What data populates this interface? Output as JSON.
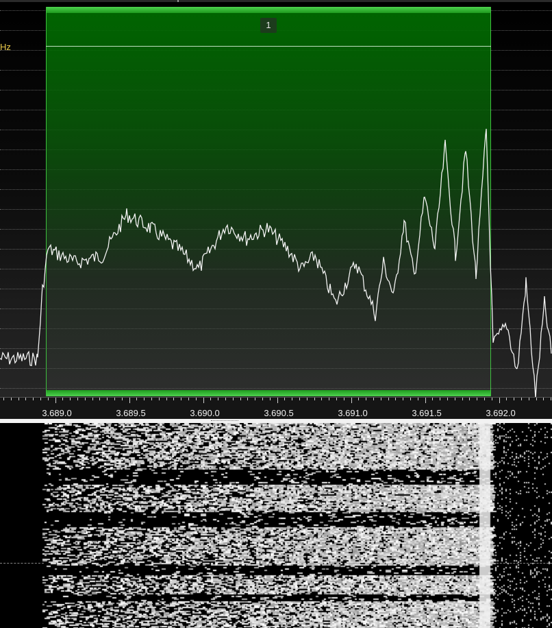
{
  "spectrum": {
    "unit_label": "Hz",
    "selection": {
      "marker_number": "1"
    }
  },
  "frequency_axis": {
    "labels": [
      "3.689.0",
      "3.689.5",
      "3.690.0",
      "3.690.5",
      "3.691.0",
      "3.691.5",
      "3.692.0"
    ]
  },
  "colors": {
    "selection_fill": "#0b6e0b",
    "selection_border": "#3fbf3f",
    "trace": "#f2f2f2",
    "unit_label": "#e8c84a",
    "background": "#000000"
  }
}
